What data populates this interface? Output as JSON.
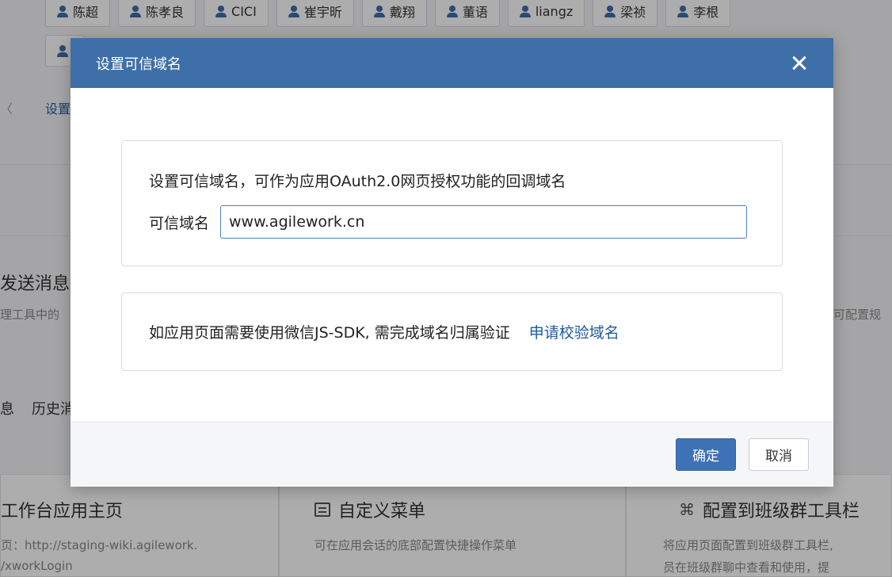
{
  "background": {
    "tags_row1": [
      "陈超",
      "陈孝良",
      "CICI",
      "崔宇昕",
      "戴翔",
      "董语",
      "liangz",
      "梁祯",
      "李根"
    ],
    "tags_row2": [
      ""
    ],
    "settings_link": "设置",
    "left_arrow": "〈",
    "send_message_title": "发送消息",
    "send_message_desc": "理工具中的",
    "right_desc": "可配置规",
    "tab_info": "息",
    "tab_history": "历史消",
    "cards": [
      {
        "title": "工作台应用主页",
        "desc1": "页：http://staging-wiki.agilework.",
        "desc2": "/xworkLogin"
      },
      {
        "title": "自定义菜单",
        "desc1": "可在应用会话的底部配置快捷操作菜单",
        "desc2": ""
      },
      {
        "title": "配置到班级群工具栏",
        "desc1": "将应用页面配置到班级群工具栏,",
        "desc2": "员在班级群聊中查看和使用，提"
      }
    ]
  },
  "dialog": {
    "title": "设置可信域名",
    "panel1_desc": "设置可信域名，可作为应用OAuth2.0网页授权功能的回调域名",
    "field_label": "可信域名",
    "field_value": "www.agilework.cn",
    "panel2_text": "如应用页面需要使用微信JS-SDK, 需完成域名归属验证",
    "panel2_link": "申请校验域名",
    "confirm_label": "确定",
    "cancel_label": "取消"
  },
  "colors": {
    "header": "#3e6fa8",
    "primary": "#3d73b6",
    "link": "#1f5a9d"
  }
}
